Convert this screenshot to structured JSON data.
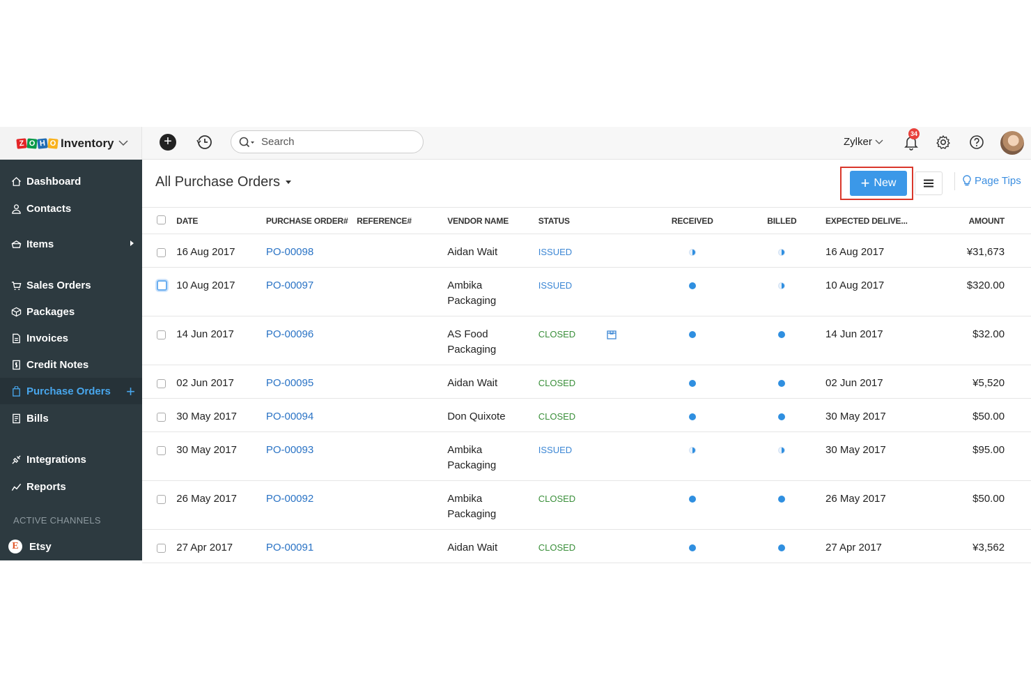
{
  "brand": {
    "logo_letters": [
      "Z",
      "O",
      "H",
      "O"
    ],
    "name": "Inventory"
  },
  "toolbar": {
    "search_placeholder": "Search",
    "org_name": "Zylker",
    "notification_count": "34"
  },
  "sidebar": {
    "items": [
      {
        "label": "Dashboard",
        "icon": "home-icon"
      },
      {
        "label": "Contacts",
        "icon": "person-icon"
      },
      {
        "label": "Items",
        "icon": "items-icon"
      },
      {
        "label": "Sales Orders",
        "icon": "cart-icon"
      },
      {
        "label": "Packages",
        "icon": "package-icon"
      },
      {
        "label": "Invoices",
        "icon": "invoice-icon"
      },
      {
        "label": "Credit Notes",
        "icon": "credit-note-icon"
      },
      {
        "label": "Purchase Orders",
        "icon": "purchase-order-icon"
      },
      {
        "label": "Bills",
        "icon": "bill-icon"
      },
      {
        "label": "Integrations",
        "icon": "integrations-icon"
      },
      {
        "label": "Reports",
        "icon": "reports-icon"
      }
    ],
    "channels_label": "ACTIVE CHANNELS",
    "channels": [
      {
        "label": "Etsy",
        "logo": "E"
      }
    ]
  },
  "main": {
    "title": "All Purchase Orders",
    "new_button": "New",
    "page_tips": "Page Tips"
  },
  "table": {
    "headers": {
      "date": "DATE",
      "po": "PURCHASE ORDER#",
      "reference": "REFERENCE#",
      "vendor": "VENDOR NAME",
      "status": "STATUS",
      "received": "RECEIVED",
      "billed": "BILLED",
      "expected": "EXPECTED DELIVE...",
      "amount": "AMOUNT"
    },
    "rows": [
      {
        "date": "16 Aug 2017",
        "po": "PO-00098",
        "reference": "",
        "vendor_line1": "Aidan Wait",
        "vendor_line2": "",
        "status": "ISSUED",
        "received": "partial",
        "billed": "partial",
        "expected": "16 Aug 2017",
        "amount": "¥31,673"
      },
      {
        "date": "10 Aug 2017",
        "po": "PO-00097",
        "reference": "",
        "vendor_line1": "Ambika",
        "vendor_line2": "Packaging",
        "status": "ISSUED",
        "received": "full",
        "billed": "partial",
        "expected": "10 Aug 2017",
        "amount": "$320.00"
      },
      {
        "date": "14 Jun 2017",
        "po": "PO-00096",
        "reference": "",
        "vendor_line1": "AS Food",
        "vendor_line2": "Packaging",
        "status": "CLOSED",
        "received": "full",
        "billed": "full",
        "expected": "14 Jun 2017",
        "amount": "$32.00"
      },
      {
        "date": "02 Jun 2017",
        "po": "PO-00095",
        "reference": "",
        "vendor_line1": "Aidan Wait",
        "vendor_line2": "",
        "status": "CLOSED",
        "received": "full",
        "billed": "full",
        "expected": "02 Jun 2017",
        "amount": "¥5,520"
      },
      {
        "date": "30 May 2017",
        "po": "PO-00094",
        "reference": "",
        "vendor_line1": "Don Quixote",
        "vendor_line2": "",
        "status": "CLOSED",
        "received": "full",
        "billed": "full",
        "expected": "30 May 2017",
        "amount": "$50.00"
      },
      {
        "date": "30 May 2017",
        "po": "PO-00093",
        "reference": "",
        "vendor_line1": "Ambika",
        "vendor_line2": "Packaging",
        "status": "ISSUED",
        "received": "partial",
        "billed": "partial",
        "expected": "30 May 2017",
        "amount": "$95.00"
      },
      {
        "date": "26 May 2017",
        "po": "PO-00092",
        "reference": "",
        "vendor_line1": "Ambika",
        "vendor_line2": "Packaging",
        "status": "CLOSED",
        "received": "full",
        "billed": "full",
        "expected": "26 May 2017",
        "amount": "$50.00"
      },
      {
        "date": "27 Apr 2017",
        "po": "PO-00091",
        "reference": "",
        "vendor_line1": "Aidan Wait",
        "vendor_line2": "",
        "status": "CLOSED",
        "received": "full",
        "billed": "full",
        "expected": "27 Apr 2017",
        "amount": "¥3,562"
      }
    ]
  },
  "colors": {
    "sidebar_bg": "#2d3a40",
    "accent": "#3b98e8",
    "issued": "#3b86d4",
    "closed": "#3a8f3a",
    "highlight": "#d9372b"
  }
}
